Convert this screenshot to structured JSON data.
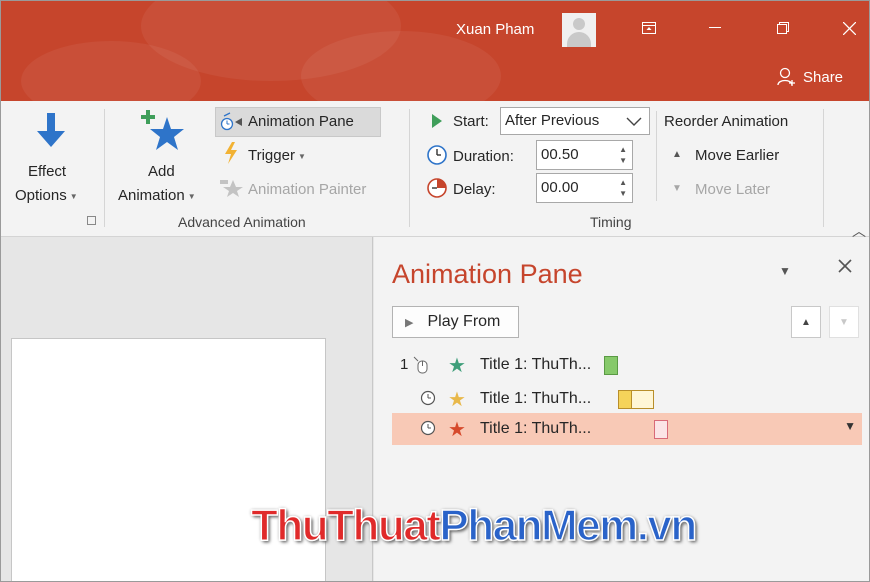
{
  "window": {
    "user_name": "Xuan Pham",
    "share_label": "Share",
    "colors": {
      "titlebar": "#c6452c",
      "accent": "#c6452c"
    },
    "icons": [
      "ribbon-display-options-icon",
      "minimize-icon",
      "restore-icon",
      "close-icon",
      "share-person-icon",
      "user-avatar"
    ]
  },
  "ribbon": {
    "effect_options": {
      "line1": "Effect",
      "line2": "Options"
    },
    "add_animation": {
      "line1": "Add",
      "line2": "Animation"
    },
    "animation_pane": "Animation Pane",
    "trigger": "Trigger",
    "animation_painter": "Animation Painter",
    "advanced_animation_group": "Advanced Animation",
    "start_label": "Start:",
    "start_value": "After Previous",
    "duration_label": "Duration:",
    "duration_value": "00.50",
    "delay_label": "Delay:",
    "delay_value": "00.00",
    "timing_group": "Timing",
    "reorder_animation": "Reorder Animation",
    "move_earlier": "Move Earlier",
    "move_later": "Move Later"
  },
  "pane": {
    "title": "Animation Pane",
    "play_from": "Play From",
    "items": [
      {
        "order": "1",
        "trigger": "on-click",
        "effect": "entrance",
        "star_color": "#3f9e7a",
        "label": "Title 1: ThuTh...",
        "bar_color": "#86c96a",
        "selected": false
      },
      {
        "order": "",
        "trigger": "after-previous",
        "effect": "emphasis",
        "star_color": "#e8b84a",
        "label": "Title 1: ThuTh...",
        "bar_color": "#f5d35a",
        "selected": false
      },
      {
        "order": "",
        "trigger": "after-previous",
        "effect": "exit",
        "star_color": "#d64a2c",
        "label": "Title 1: ThuTh...",
        "bar_color": "#e8a0a8",
        "selected": true
      }
    ]
  },
  "watermark": {
    "part1": "ThuThuat",
    "part2": "PhanMem.vn"
  }
}
